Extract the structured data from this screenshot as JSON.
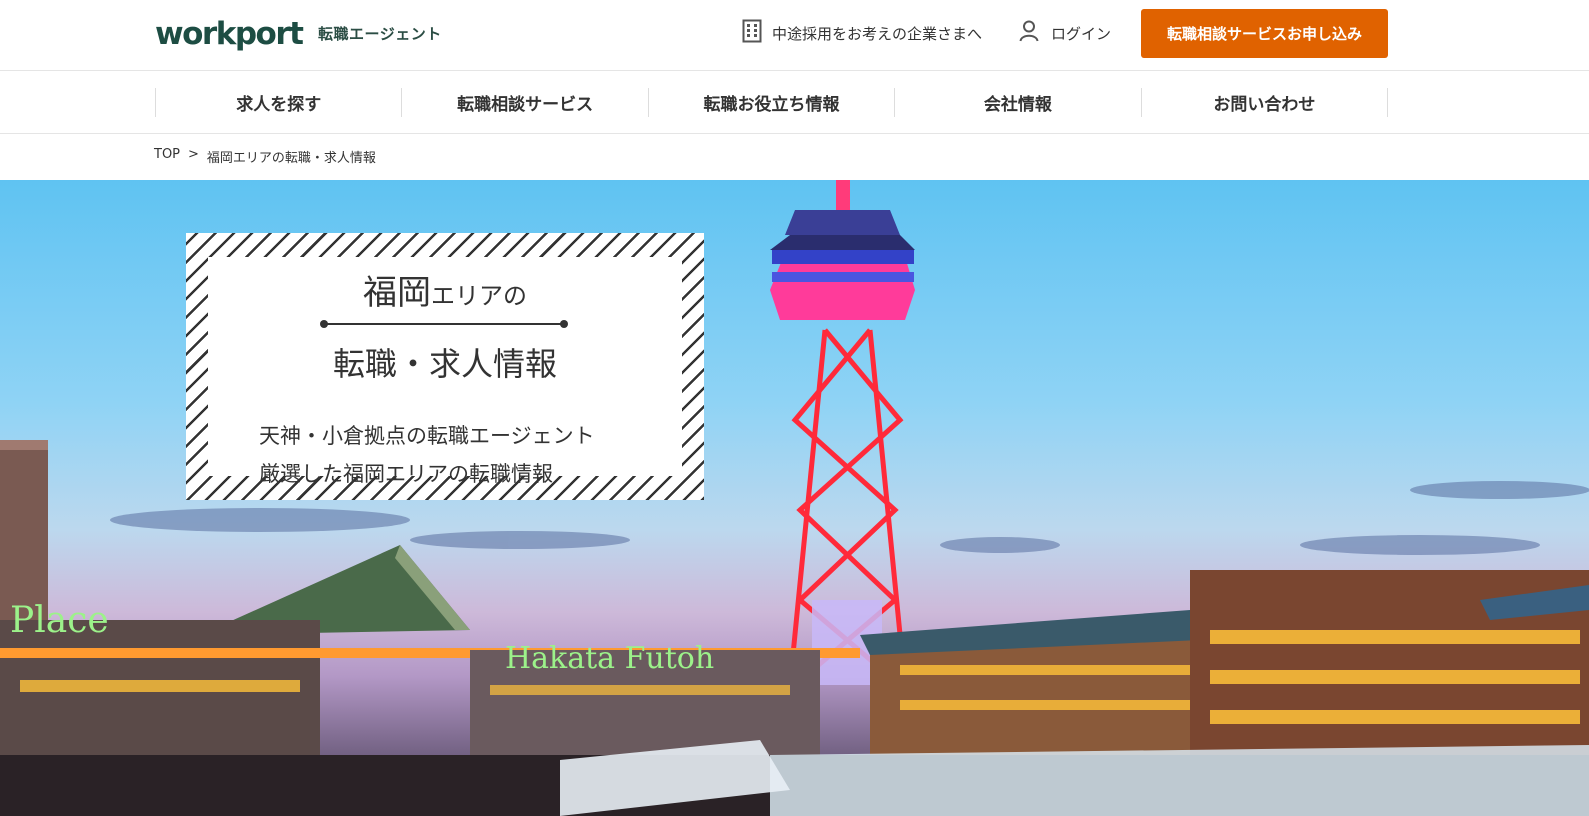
{
  "header": {
    "logo_text": "workport",
    "logo_sub": "転職エージェント",
    "corporate_link": "中途採用をお考えの企業さまへ",
    "login_link": "ログイン",
    "cta_button": "転職相談サービスお申し込み"
  },
  "nav": {
    "items": [
      {
        "label": "求人を探す"
      },
      {
        "label": "転職相談サービス"
      },
      {
        "label": "転職お役立ち情報"
      },
      {
        "label": "会社情報"
      },
      {
        "label": "お問い合わせ"
      }
    ]
  },
  "breadcrumb": {
    "home": "TOP",
    "separator": ">",
    "current": "福岡エリアの転職・求人情報"
  },
  "hero": {
    "title_big": "福岡",
    "title_small": "エリアの",
    "title_main": "転職・求人情報",
    "lead_line1": "天神・小倉拠点の転職エージェント",
    "lead_line2": "厳選した福岡エリアの転職情報",
    "photo_signs": [
      "Place",
      "Hakata Futoh"
    ]
  },
  "colors": {
    "brand_green": "#1d4d43",
    "accent_orange": "#e06200",
    "logo_dot": "#e97e1a"
  },
  "icons": [
    "building-icon",
    "user-icon"
  ]
}
